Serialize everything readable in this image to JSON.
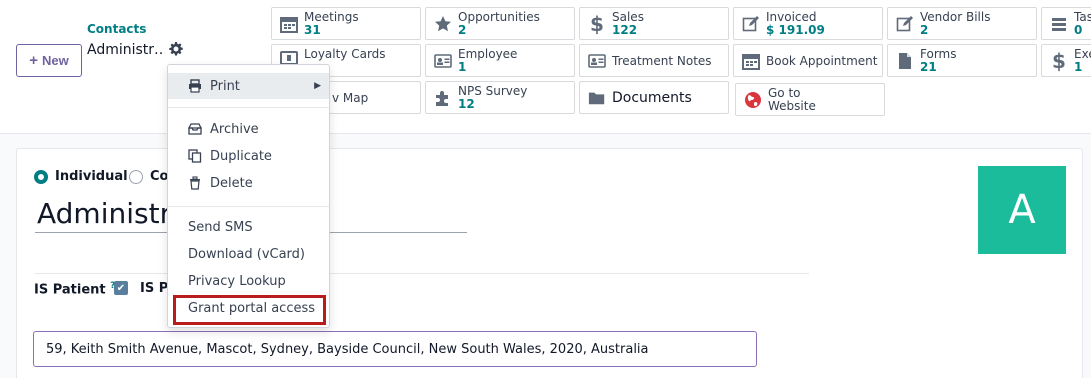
{
  "control_panel": {
    "new_button": "New",
    "breadcrumb": "Contacts",
    "record_name": "Administr…"
  },
  "smart_buttons": [
    {
      "label": "Meetings",
      "value": "31",
      "icon": "calendar-icon"
    },
    {
      "label": "Opportunities",
      "value": "2",
      "icon": "star-icon"
    },
    {
      "label": "Sales",
      "value": "122",
      "icon": "dollar-icon"
    },
    {
      "label": "Invoiced",
      "value": "$ 191.09",
      "icon": "pencil-square-icon"
    },
    {
      "label": "Vendor Bills",
      "value": "2",
      "icon": "pencil-square-icon"
    },
    {
      "label": "Tas",
      "value": "0",
      "icon": "tasks-icon"
    },
    {
      "label": "Loyalty Cards",
      "value": "",
      "icon": "loyalty-card-icon"
    },
    {
      "label": "Employee",
      "value": "1",
      "icon": "id-card-icon"
    },
    {
      "label": "Treatment Notes",
      "value": "",
      "icon": "id-card-icon"
    },
    {
      "label": "Book Appointment",
      "value": "",
      "icon": "calendar-icon"
    },
    {
      "label": "Forms",
      "value": "21",
      "icon": "file-icon"
    },
    {
      "label": "Exe",
      "value": "1",
      "icon": "dollar-icon"
    },
    {
      "label": "v Map",
      "value": "",
      "icon": "map-icon"
    },
    {
      "label": "NPS Survey",
      "value": "12",
      "icon": "puzzle-icon"
    },
    {
      "label": "Documents",
      "value": "",
      "icon": "folder-icon"
    },
    {
      "label": "Go to",
      "value": "Website",
      "icon": "globe-icon"
    }
  ],
  "menu": {
    "print": "Print",
    "archive": "Archive",
    "duplicate": "Duplicate",
    "delete": "Delete",
    "send_sms": "Send SMS",
    "download_vcard": "Download (vCard)",
    "privacy_lookup": "Privacy Lookup",
    "grant_portal": "Grant portal access"
  },
  "form": {
    "type_individual": "Individual",
    "type_company": "Co",
    "name": "Administra",
    "avatar_letter": "A",
    "is_patient_label": "IS Patient",
    "help_mark": "?",
    "is_pr_label": "IS Pr",
    "address": "59, Keith Smith Avenue, Mascot, Sydney, Bayside Council, New South Wales, 2020, Australia"
  },
  "colors": {
    "accent": "#017e84",
    "primary": "#71639e",
    "avatar": "#1abc9c",
    "highlight": "#b91c1c"
  }
}
